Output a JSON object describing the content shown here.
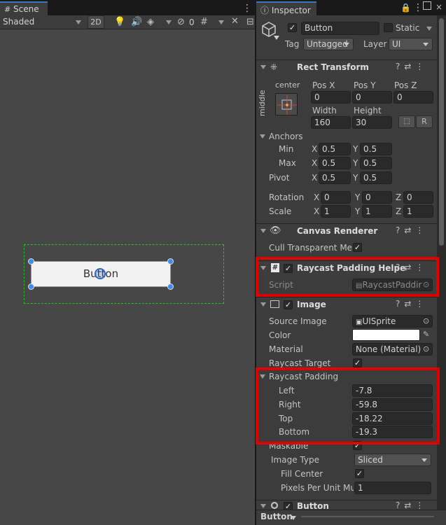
{
  "scene": {
    "tab_label": "Scene",
    "shading_mode": "Shaded",
    "btn_2d": "2D",
    "hidden_count": "0",
    "preview_button_label": "Button"
  },
  "inspector": {
    "tab_label": "Inspector",
    "object_name": "Button",
    "static_label": "Static",
    "tag_label": "Tag",
    "tag_value": "Untagged",
    "layer_label": "Layer",
    "layer_value": "UI",
    "rect_transform": {
      "title": "Rect Transform",
      "anchor_preset_h": "center",
      "anchor_preset_v": "middle",
      "pos_x_label": "Pos X",
      "pos_y_label": "Pos Y",
      "pos_z_label": "Pos Z",
      "pos_x": "0",
      "pos_y": "0",
      "pos_z": "0",
      "width_label": "Width",
      "height_label": "Height",
      "width": "160",
      "height": "30",
      "r_label": "R",
      "anchors_label": "Anchors",
      "min_label": "Min",
      "max_label": "Max",
      "min_x": "0.5",
      "min_y": "0.5",
      "max_x": "0.5",
      "max_y": "0.5",
      "pivot_label": "Pivot",
      "pivot_x": "0.5",
      "pivot_y": "0.5",
      "rotation_label": "Rotation",
      "rot_x": "0",
      "rot_y": "0",
      "rot_z": "0",
      "scale_label": "Scale",
      "scale_x": "1",
      "scale_y": "1",
      "scale_z": "1",
      "x": "X",
      "y": "Y",
      "z": "Z"
    },
    "canvas_renderer": {
      "title": "Canvas Renderer",
      "cull_label": "Cull Transparent Mes"
    },
    "raycast_helper": {
      "title": "Raycast Padding Helpe",
      "script_label": "Script",
      "script_value": "RaycastPaddir"
    },
    "image": {
      "title": "Image",
      "source_image_label": "Source Image",
      "source_image_value": "UISprite",
      "color_label": "Color",
      "material_label": "Material",
      "material_value": "None (Material)",
      "raycast_target_label": "Raycast Target",
      "raycast_padding_label": "Raycast Padding",
      "left_label": "Left",
      "left_value": "-7.8",
      "right_label": "Right",
      "right_value": "-59.8",
      "top_label": "Top",
      "top_value": "-18.22",
      "bottom_label": "Bottom",
      "bottom_value": "-19.3",
      "maskable_label": "Maskable",
      "image_type_label": "Image Type",
      "image_type_value": "Sliced",
      "fill_center_label": "Fill Center",
      "ppu_label": "Pixels Per Unit Mul",
      "ppu_value": "1"
    },
    "button_component": {
      "title": "Button"
    },
    "footer_label": "Button"
  },
  "colors": {
    "highlight": "#e00000",
    "accent_tab": "#3a79bb",
    "selection_outline": "#22c422",
    "handle": "#3d8cf0"
  }
}
